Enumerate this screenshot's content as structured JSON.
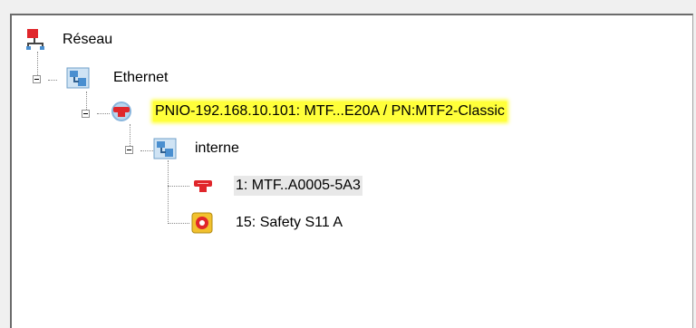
{
  "tree": {
    "nodes": [
      {
        "label": "Réseau",
        "icon": "network-root-icon"
      },
      {
        "label": "Ethernet",
        "icon": "ethernet-network-icon"
      },
      {
        "label": "PNIO-192.168.10.101: MTF...E20A / PN:MTF2-Classic",
        "icon": "profinet-device-icon"
      },
      {
        "label": "interne",
        "icon": "internal-network-icon"
      },
      {
        "label": "1: MTF..A0005-5A3",
        "icon": "module-device-icon"
      },
      {
        "label": "15: Safety S11 A",
        "icon": "safety-module-icon"
      }
    ]
  },
  "colors": {
    "highlight": "#ffff3a",
    "device_red": "#e0262b",
    "network_blue": "#4a8fd0"
  }
}
